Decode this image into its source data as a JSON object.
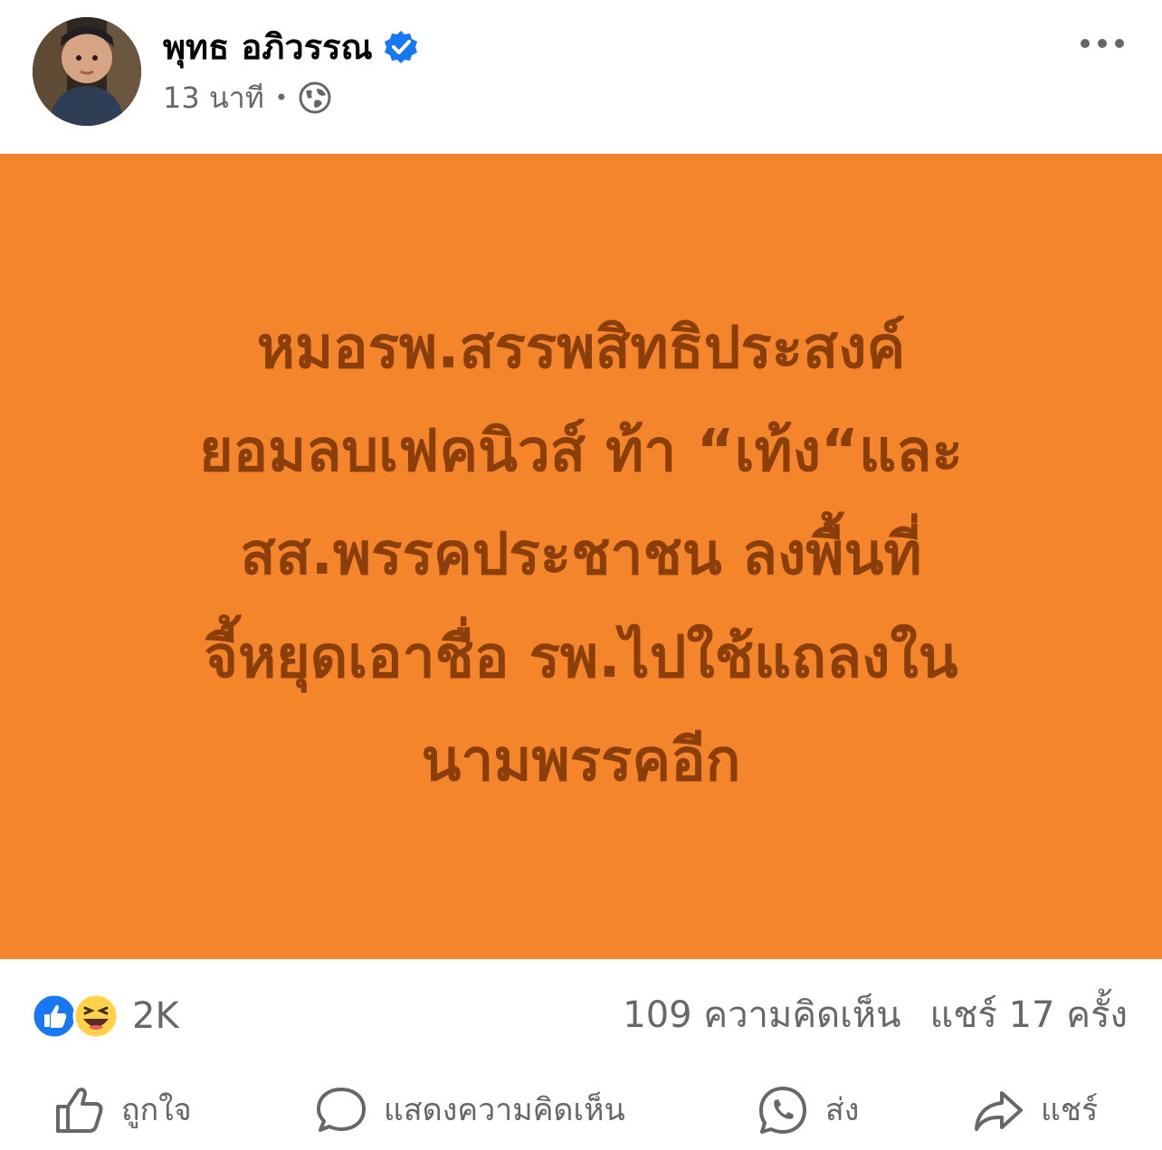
{
  "post": {
    "author": "พุทธ อภิวรรณ",
    "verified": true,
    "time": "13 นาที",
    "audience_icon": "globe-icon",
    "text_lines": [
      "หมอรพ.สรรพสิทธิประสงค์",
      "ยอมลบเฟคนิวส์ ท้า “เท้ง“และ",
      "สส.พรรคประชาชน ลงพื้นที่",
      "จี้หยุดเอาชื่อ รพ.ไปใช้แถลงใน",
      "นามพรรคอีก"
    ],
    "background_color": "#f5852a",
    "text_color": "#8a3f0b"
  },
  "stats": {
    "reaction_icons": [
      "like-reaction-icon",
      "haha-reaction-icon"
    ],
    "reaction_count": "2K",
    "comments": "109 ความคิดเห็น",
    "shares": "แชร์ 17 ครั้ง"
  },
  "actions": {
    "like": "ถูกใจ",
    "comment": "แสดงความคิดเห็น",
    "send": "ส่ง",
    "share": "แชร์"
  },
  "colors": {
    "like_blue": "#1877f2",
    "secondary_text": "#65676b"
  }
}
